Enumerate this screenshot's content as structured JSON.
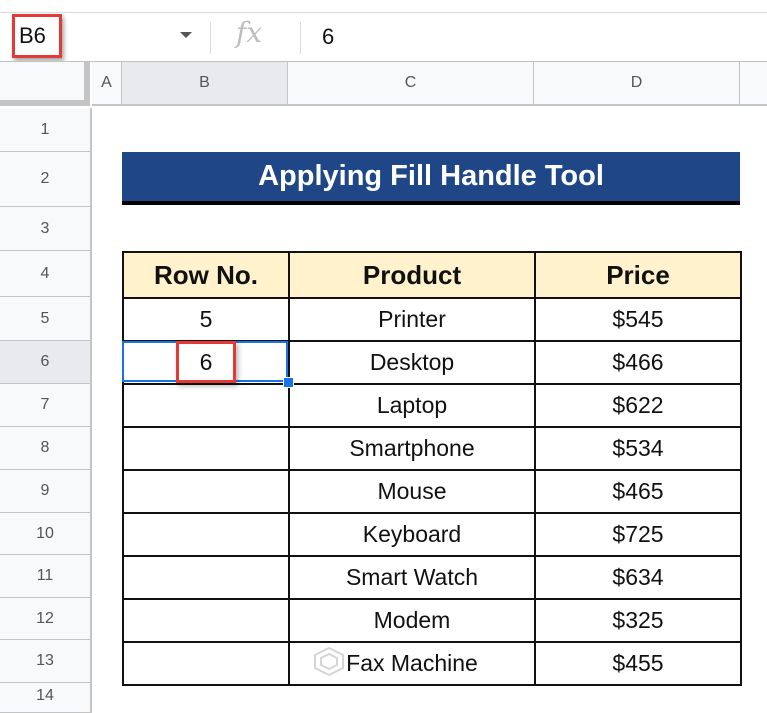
{
  "formula_bar": {
    "name_box": "B6",
    "fx_label": "fx",
    "value": "6"
  },
  "columns": [
    "A",
    "B",
    "C",
    "D"
  ],
  "selected_column": "B",
  "rows": [
    "1",
    "2",
    "3",
    "4",
    "5",
    "6",
    "7",
    "8",
    "9",
    "10",
    "11",
    "12",
    "13",
    "14"
  ],
  "selected_row": "6",
  "sheet": {
    "title": "Applying Fill Handle Tool",
    "headers": [
      "Row No.",
      "Product",
      "Price"
    ],
    "records": [
      {
        "row_no": "5",
        "product": "Printer",
        "price": "$545"
      },
      {
        "row_no": "6",
        "product": "Desktop",
        "price": "$466"
      },
      {
        "row_no": "",
        "product": "Laptop",
        "price": "$622"
      },
      {
        "row_no": "",
        "product": "Smartphone",
        "price": "$534"
      },
      {
        "row_no": "",
        "product": "Mouse",
        "price": "$465"
      },
      {
        "row_no": "",
        "product": "Keyboard",
        "price": "$725"
      },
      {
        "row_no": "",
        "product": "Smart Watch",
        "price": "$634"
      },
      {
        "row_no": "",
        "product": "Modem",
        "price": "$325"
      },
      {
        "row_no": "",
        "product": "Fax Machine",
        "price": "$455"
      }
    ]
  },
  "colors": {
    "title_fill": "#1f4788",
    "header_fill": "#fff2cc",
    "selection": "#1a73e8",
    "highlight": "#e53935"
  }
}
